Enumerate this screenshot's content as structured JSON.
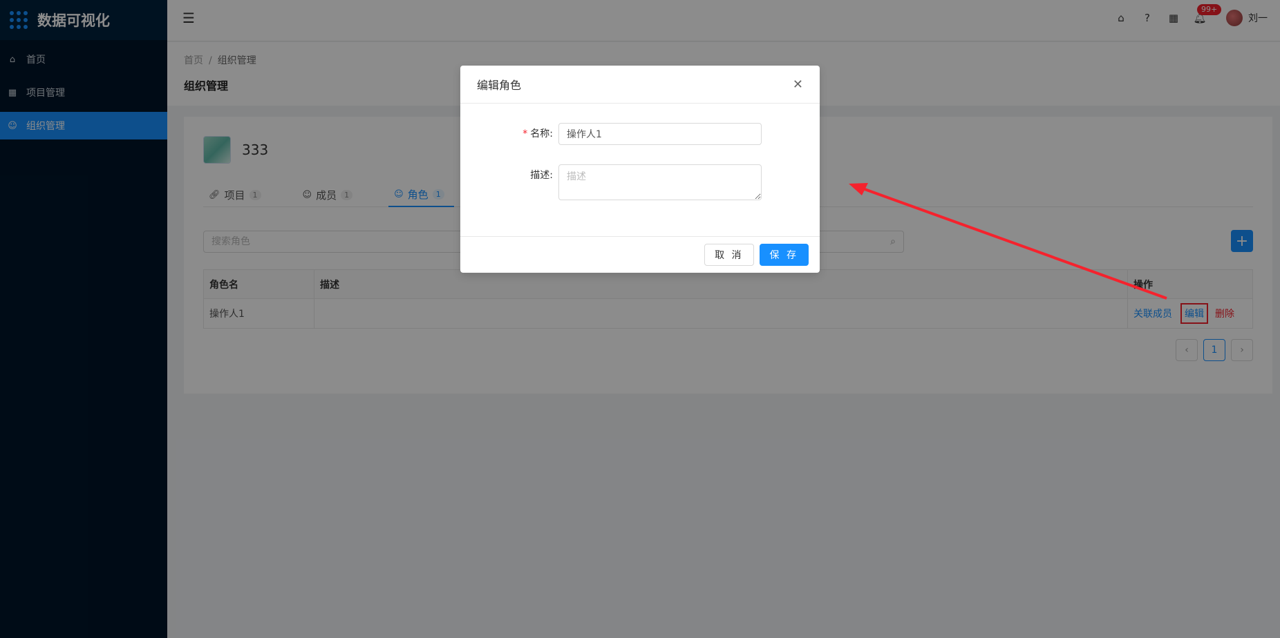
{
  "app": {
    "title": "数据可视化"
  },
  "sidebar": {
    "items": [
      {
        "label": "首页",
        "icon": "home-icon"
      },
      {
        "label": "项目管理",
        "icon": "grid-icon"
      },
      {
        "label": "组织管理",
        "icon": "users-icon",
        "active": true
      }
    ]
  },
  "header": {
    "badge": "99+",
    "username": "刘一"
  },
  "breadcrumb": {
    "home": "首页",
    "separator": "/",
    "current": "组织管理"
  },
  "page": {
    "title": "组织管理"
  },
  "org": {
    "name": "333"
  },
  "tabs": [
    {
      "label": "项目",
      "count": "1"
    },
    {
      "label": "成员",
      "count": "1"
    },
    {
      "label": "角色",
      "count": "1",
      "active": true
    }
  ],
  "search": {
    "placeholder": "搜索角色"
  },
  "table": {
    "headers": {
      "name": "角色名",
      "desc": "描述",
      "ops": "操作"
    },
    "rows": [
      {
        "name": "操作人1",
        "desc": "",
        "op_link": "关联成员",
        "op_edit": "编辑",
        "op_delete": "删除"
      }
    ]
  },
  "pagination": {
    "current": "1"
  },
  "modal": {
    "title": "编辑角色",
    "name_label": "名称:",
    "name_required": "*",
    "name_value": "操作人1",
    "desc_label": "描述:",
    "desc_placeholder": "描述",
    "cancel": "取 消",
    "save": "保 存"
  },
  "colors": {
    "primary": "#1890ff",
    "danger": "#f5222d",
    "sidebar": "#001529"
  }
}
